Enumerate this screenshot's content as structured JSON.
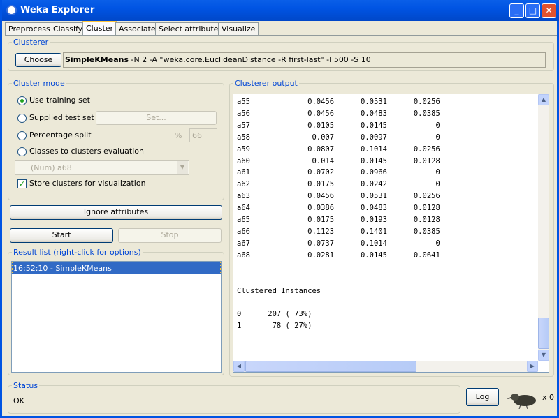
{
  "window": {
    "title": "Weka Explorer"
  },
  "tabs": [
    {
      "label": "Preprocess"
    },
    {
      "label": "Classify"
    },
    {
      "label": "Cluster",
      "selected": true
    },
    {
      "label": "Associate"
    },
    {
      "label": "Select attributes"
    },
    {
      "label": "Visualize"
    }
  ],
  "clusterer": {
    "legend": "Clusterer",
    "choose_label": "Choose",
    "name": "SimpleKMeans",
    "options": " -N 2 -A \"weka.core.EuclideanDistance -R first-last\" -I 500 -S 10"
  },
  "cluster_mode": {
    "legend": "Cluster mode",
    "use_training": "Use training set",
    "supplied_test": "Supplied test set",
    "set_label": "Set...",
    "percentage_split": "Percentage split",
    "percent_symbol": "%",
    "percent_value": "66",
    "classes_eval": "Classes to clusters evaluation",
    "class_attr": "(Num) a68",
    "store_clusters": "Store clusters for visualization",
    "selected": "Use training set",
    "store_checked": true
  },
  "ignore_label": "Ignore attributes",
  "start_label": "Start",
  "stop_label": "Stop",
  "result_list": {
    "legend": "Result list (right-click for options)",
    "items": [
      "16:52:10 - SimpleKMeans"
    ]
  },
  "output": {
    "legend": "Clusterer output",
    "text": "a55             0.0456      0.0531      0.0256\na56             0.0456      0.0483      0.0385\na57             0.0105      0.0145           0\na58              0.007      0.0097           0\na59             0.0807      0.1014      0.0256\na60              0.014      0.0145      0.0128\na61             0.0702      0.0966           0\na62             0.0175      0.0242           0\na63             0.0456      0.0531      0.0256\na64             0.0386      0.0483      0.0128\na65             0.0175      0.0193      0.0128\na66             0.1123      0.1401      0.0385\na67             0.0737      0.1014           0\na68             0.0281      0.0145      0.0641\n\n\nClustered Instances\n\n0      207 ( 73%)\n1       78 ( 27%)"
  },
  "status": {
    "legend": "Status",
    "text": "OK",
    "log_label": "Log",
    "task_count": "x 0"
  },
  "colors": {
    "title_bar": "#0054e3",
    "legend": "#0046d5",
    "selection": "#316ac5"
  }
}
